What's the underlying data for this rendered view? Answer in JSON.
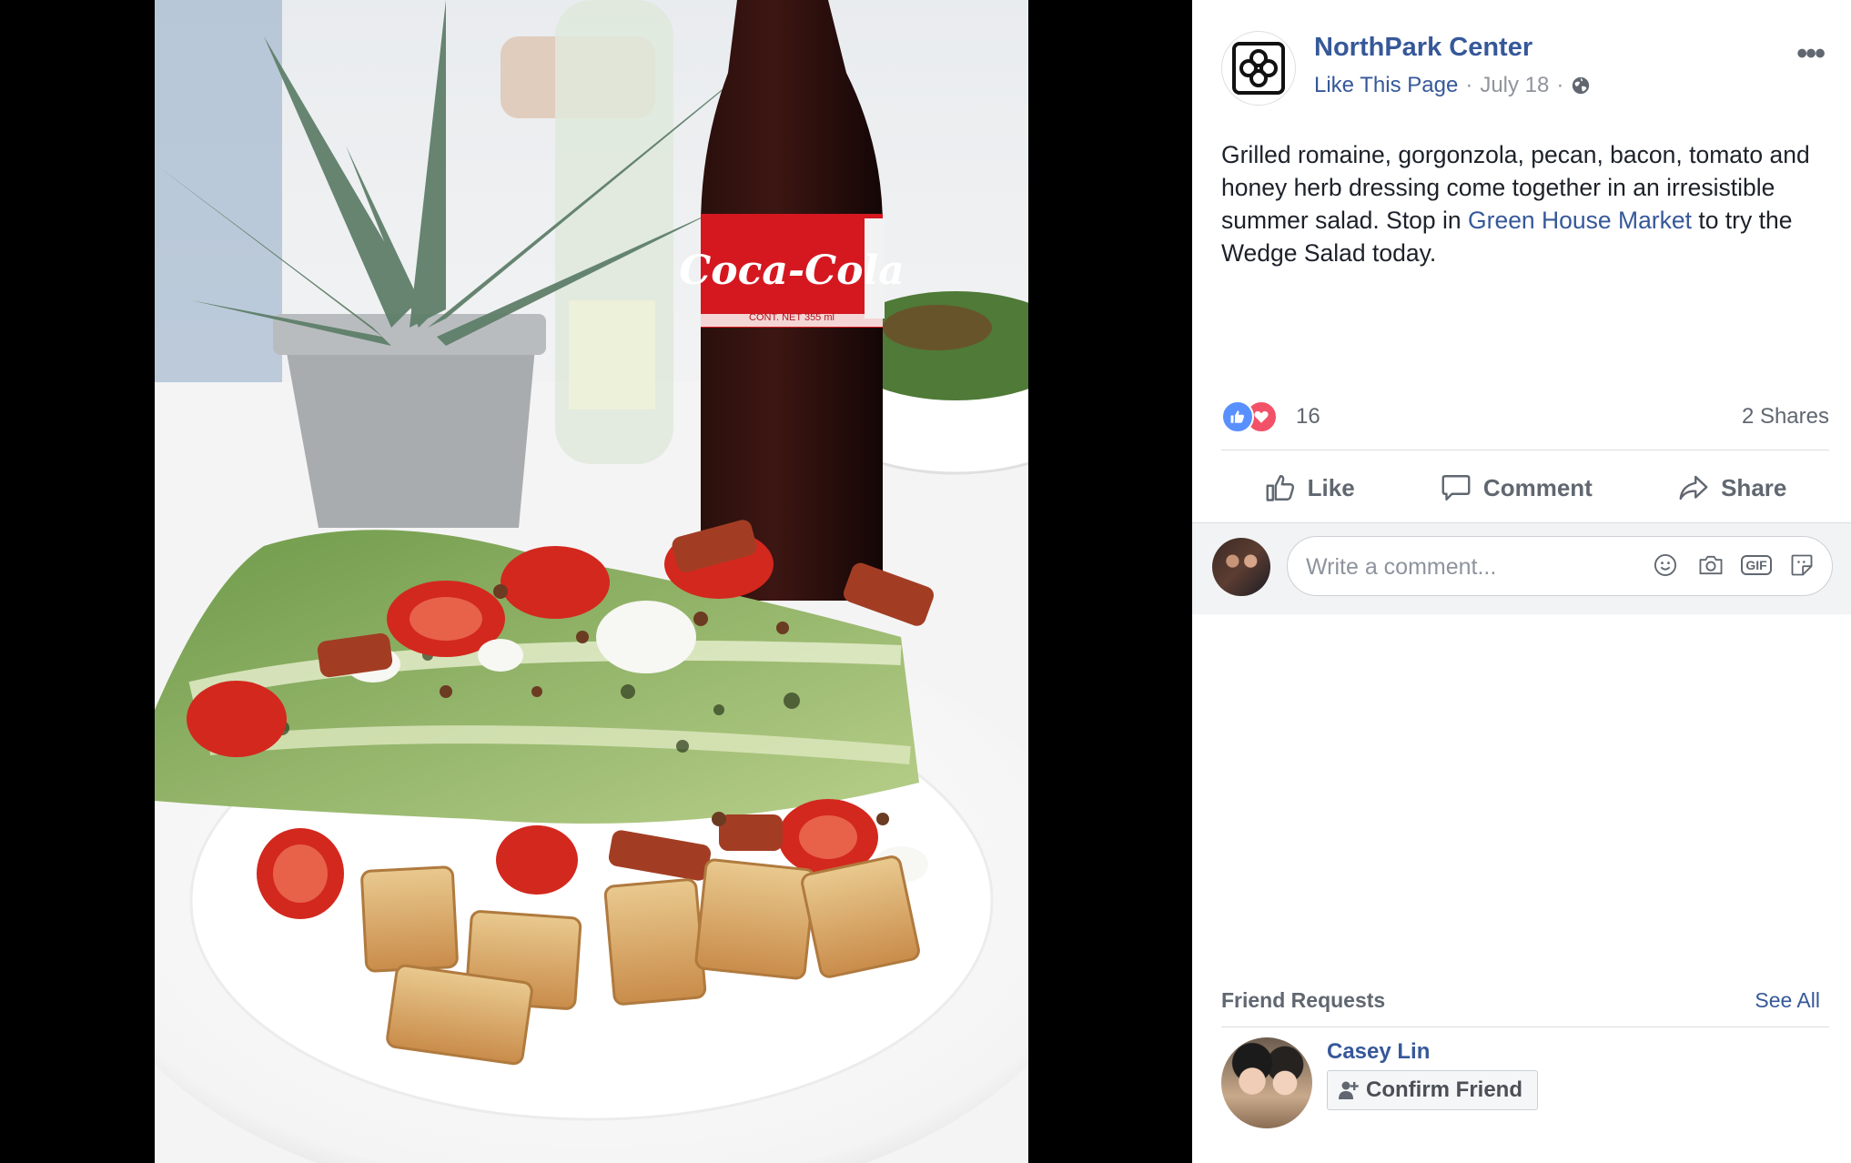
{
  "photo": {
    "bottle_label": "Coca-Cola",
    "bottle_sublabel": "CONT. NET 355 ml"
  },
  "post": {
    "page_name": "NorthPark Center",
    "like_page_label": "Like This Page",
    "separator": "·",
    "date": "July 18",
    "privacy_icon": "globe-icon",
    "more_icon": "more-options-icon",
    "text_part1": "Grilled romaine, gorgonzola, pecan, bacon, tomato and honey herb dressing come together in an irresistible summer salad. Stop in ",
    "text_link": "Green House Market",
    "text_part2": " to try the Wedge Salad today.",
    "reaction_count": "16",
    "shares": "2 Shares",
    "actions": {
      "like": "Like",
      "comment": "Comment",
      "share": "Share"
    },
    "comment_placeholder": "Write a comment...",
    "gif_label": "GIF"
  },
  "friend_requests": {
    "title": "Friend Requests",
    "see_all": "See All",
    "items": [
      {
        "name": "Casey Lin",
        "button": "Confirm Friend"
      }
    ]
  },
  "colors": {
    "link": "#365899",
    "secondary_text": "#606770",
    "like_reaction": "#5890ff",
    "love_reaction": "#f25268",
    "backdrop": "#000000"
  }
}
